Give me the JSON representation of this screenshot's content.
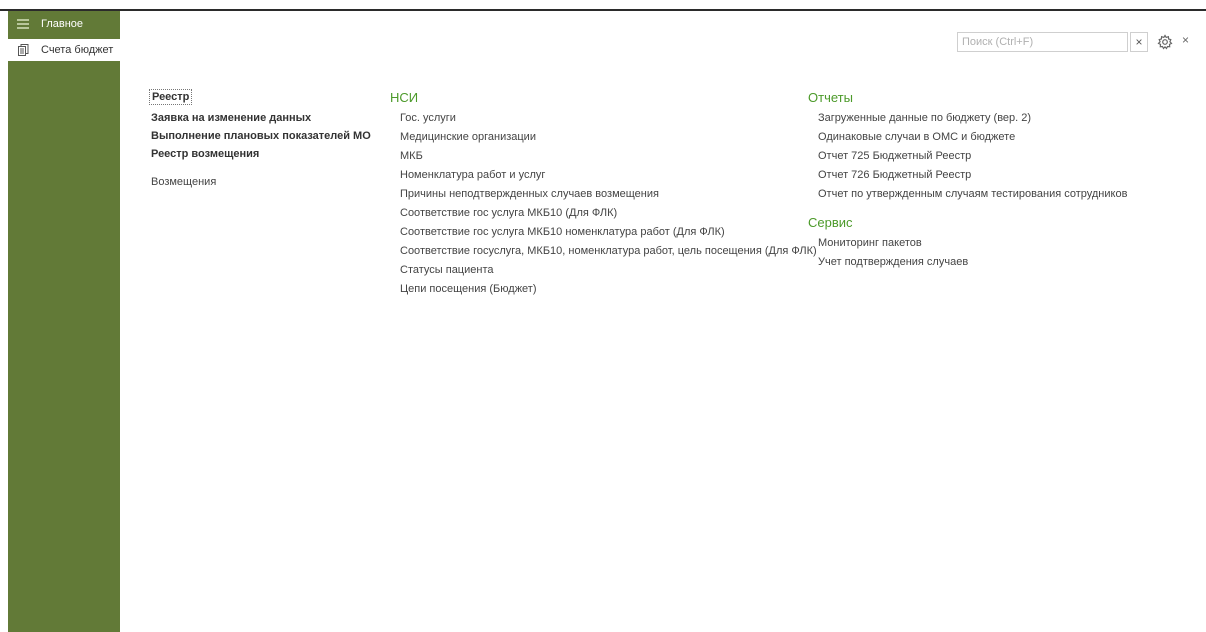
{
  "colors": {
    "sidebar": "#627a37",
    "group_title": "#4c9a2a"
  },
  "sidebar": {
    "items": [
      {
        "label": "Главное",
        "icon": "menu-icon"
      },
      {
        "label": "Счета бюджет",
        "icon": "document-stack-icon"
      }
    ]
  },
  "search": {
    "placeholder": "Поиск (Ctrl+F)",
    "clear_label": "×",
    "close_label": "×"
  },
  "main": {
    "col1": {
      "links": [
        "Реестр",
        "Заявка на изменение данных",
        "Выполнение плановых показателей МО",
        "Реестр возмещения"
      ],
      "extra": "Возмещения"
    },
    "col2": {
      "title": "НСИ",
      "items": [
        "Гос. услуги",
        "Медицинские организации",
        "МКБ",
        "Номенклатура работ и услуг",
        "Причины неподтвержденных случаев возмещения",
        "Соответствие гос услуга МКБ10 (Для ФЛК)",
        "Соответствие гос услуга МКБ10 номенклатура работ (Для ФЛК)",
        "Соответствие госуслуга, МКБ10, номенклатура работ, цель посещения (Для ФЛК)",
        "Статусы пациента",
        "Цепи посещения (Бюджет)"
      ]
    },
    "col3": {
      "reports": {
        "title": "Отчеты",
        "items": [
          "Загруженные данные по бюджету (вер. 2)",
          "Одинаковые случаи в ОМС и бюджете",
          "Отчет 725 Бюджетный Реестр",
          "Отчет 726 Бюджетный Реестр",
          "Отчет по утвержденным случаям тестирования сотрудников"
        ]
      },
      "service": {
        "title": "Сервис",
        "items": [
          "Мониторинг пакетов",
          "Учет подтверждения случаев"
        ]
      }
    }
  }
}
